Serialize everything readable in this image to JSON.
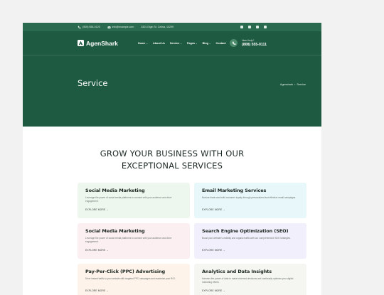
{
  "topbar": {
    "phone": "(505) 555-0125",
    "email": "info@example.com",
    "address": "3301 Elgin St. Celina, 10299",
    "social": [
      "facebook-icon",
      "twitter-icon",
      "youtube-icon",
      "instagram-icon"
    ]
  },
  "nav": {
    "brand": "AgenShark",
    "items": [
      {
        "label": "Home",
        "has_dropdown": true
      },
      {
        "label": "About Us",
        "has_dropdown": false
      },
      {
        "label": "Service",
        "has_dropdown": true
      },
      {
        "label": "Pages",
        "has_dropdown": true
      },
      {
        "label": "Blog",
        "has_dropdown": true
      },
      {
        "label": "Contact",
        "has_dropdown": false
      }
    ],
    "call_label": "Need help?",
    "call_number": "(808) 555-0111"
  },
  "hero": {
    "title": "Service",
    "breadcrumb_home": "Agenshark",
    "breadcrumb_sep": "›",
    "breadcrumb_current": "Service"
  },
  "section": {
    "title_line1": "GROW YOUR BUSINESS WITH OUR",
    "title_line2": "EXCEPTIONAL SERVICES"
  },
  "services": [
    {
      "title": "Social Media Marketing",
      "desc": "Leverage the power of social media platforms to connect with your audience and drive engagement.",
      "more": "EXPLORE MORE →",
      "bg": "#eef7ee"
    },
    {
      "title": "Email Marketing Services",
      "desc": "Nurture leads and build customer loyalty through personalized and effective email campaigns.",
      "more": "EXPLORE MORE →",
      "bg": "#e8f7fa"
    },
    {
      "title": "Social Media Marketing",
      "desc": "Leverage the power of social media platforms to connect with your audience and drive engagement.",
      "more": "EXPLORE MORE →",
      "bg": "#fbeff2"
    },
    {
      "title": "Search Engine Optimization (SEO)",
      "desc": "Boost your website's visibility and organic traffic with our comprehensive SEO strategies.",
      "more": "EXPLORE MORE →",
      "bg": "#f1effb"
    },
    {
      "title": "Pay-Per-Click (PPC) Advertising",
      "desc": "Drive instant traffic to your website with targeted PPC campaigns and maximize your ROI.",
      "more": "EXPLORE MORE →",
      "bg": "#fdf3ea"
    },
    {
      "title": "Analytics and Data Insights",
      "desc": "Harness the power of data to make informed decisions and continually optimize your digital marketing efforts.",
      "more": "EXPLORE MORE →",
      "bg": "#f5f6f1"
    }
  ],
  "colors": {
    "header": "#1e5a41",
    "topbar": "#2a6a4e"
  }
}
